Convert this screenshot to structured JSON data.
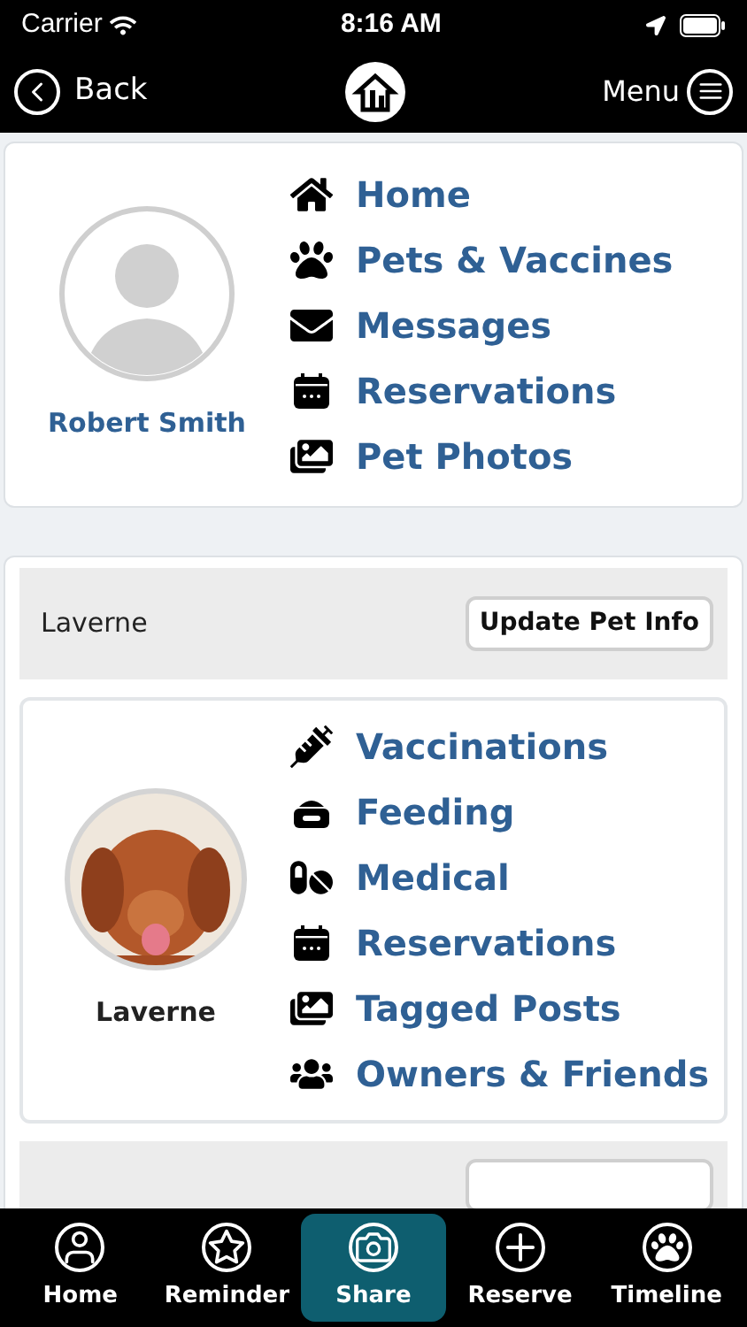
{
  "status_bar": {
    "carrier": "Carrier",
    "time": "8:16 AM"
  },
  "nav": {
    "back": "Back",
    "menu": "Menu"
  },
  "profile": {
    "name": "Robert Smith",
    "links": [
      {
        "label": "Home"
      },
      {
        "label": "Pets & Vaccines"
      },
      {
        "label": "Messages"
      },
      {
        "label": "Reservations"
      },
      {
        "label": "Pet Photos"
      }
    ]
  },
  "pet": {
    "header": "Laverne",
    "update_button": "Update Pet Info",
    "name": "Laverne",
    "links": [
      {
        "label": "Vaccinations"
      },
      {
        "label": "Feeding"
      },
      {
        "label": "Medical"
      },
      {
        "label": "Reservations"
      },
      {
        "label": "Tagged Posts"
      },
      {
        "label": "Owners & Friends"
      }
    ]
  },
  "tab_bar": [
    {
      "label": "Home",
      "selected": false
    },
    {
      "label": "Reminder",
      "selected": false
    },
    {
      "label": "Share",
      "selected": true
    },
    {
      "label": "Reserve",
      "selected": false
    },
    {
      "label": "Timeline",
      "selected": false
    }
  ]
}
